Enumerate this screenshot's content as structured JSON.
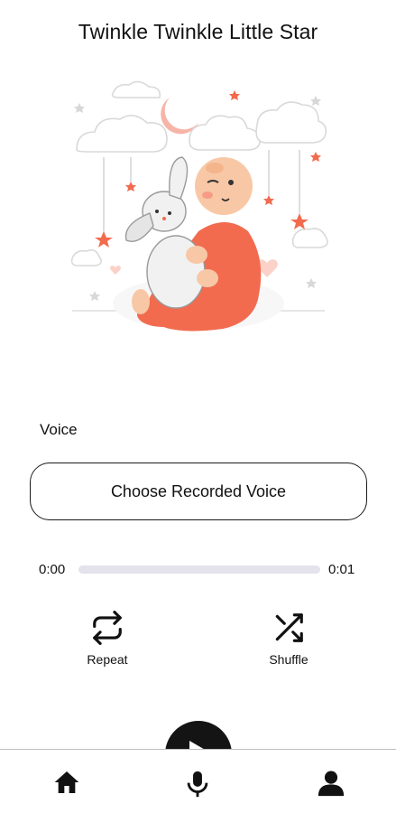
{
  "header": {
    "title": "Twinkle Twinkle Little Star"
  },
  "voice_section": {
    "label": "Voice",
    "choose_button_label": "Choose Recorded Voice"
  },
  "player": {
    "current_time": "0:00",
    "total_time": "0:01",
    "progress": 0.0
  },
  "controls": {
    "repeat_label": "Repeat",
    "shuffle_label": "Shuffle"
  },
  "bottom_nav": {
    "items": [
      {
        "icon": "home-icon"
      },
      {
        "icon": "microphone-icon"
      },
      {
        "icon": "profile-icon"
      }
    ]
  },
  "colors": {
    "accent": "#f26b4f",
    "primary": "#141414",
    "track": "#e4e2ea"
  }
}
